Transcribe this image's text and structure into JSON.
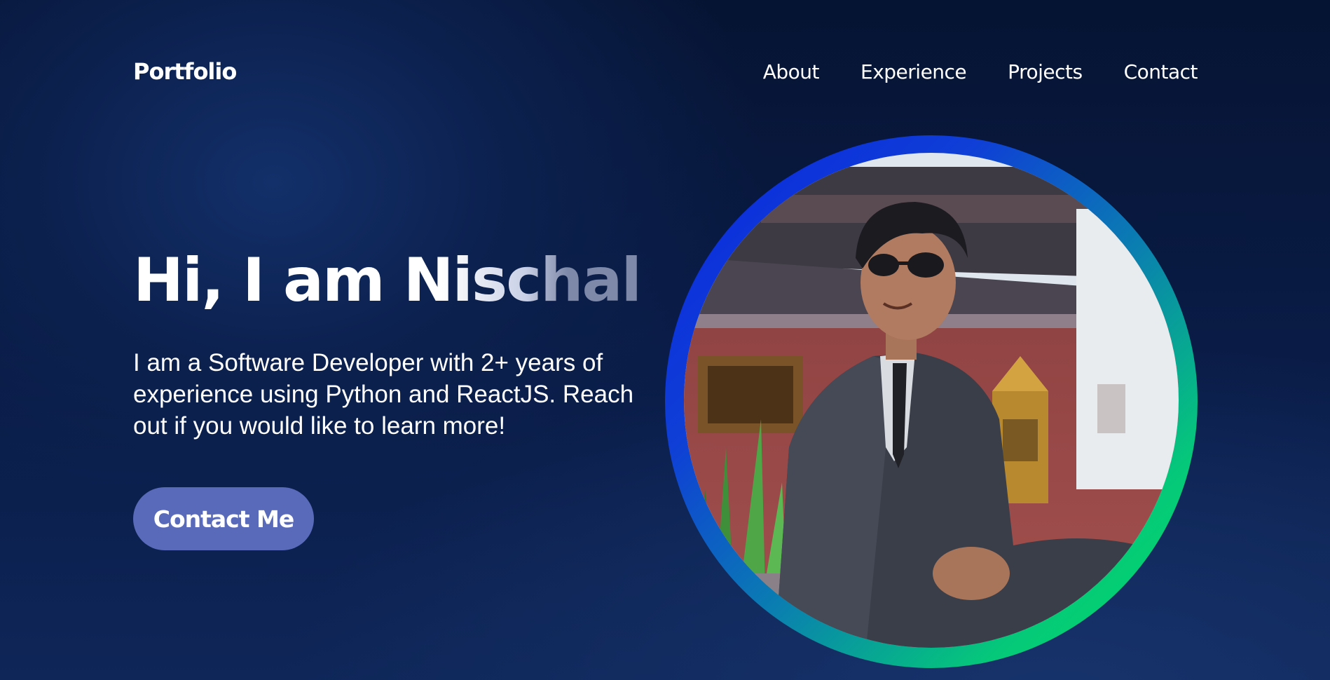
{
  "nav": {
    "logo": "Portfolio",
    "links": [
      {
        "label": "About"
      },
      {
        "label": "Experience"
      },
      {
        "label": "Projects"
      },
      {
        "label": "Contact"
      }
    ]
  },
  "hero": {
    "title": "Hi, I am Nischal",
    "description": "I am a Software Developer with 2+ years of experience using Python and ReactJS. Reach out if you would like to learn more!",
    "cta_label": "Contact Me"
  },
  "colors": {
    "background": "#0b1e4a",
    "cta": "#5a6abb",
    "ring_start": "#0a24e0",
    "ring_end": "#02de62"
  }
}
